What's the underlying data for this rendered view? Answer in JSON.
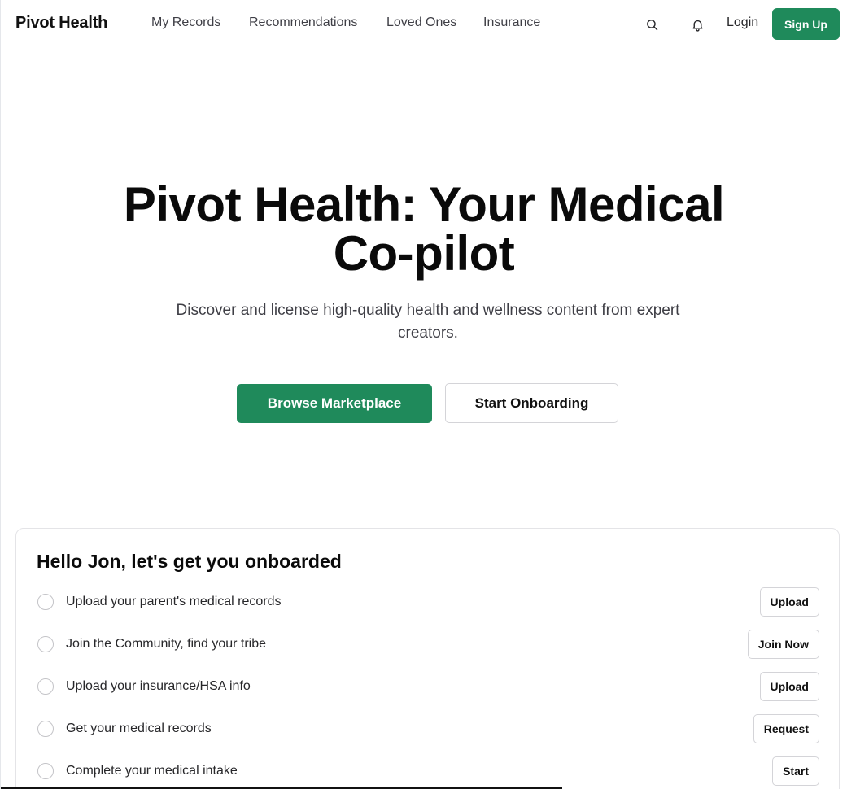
{
  "header": {
    "brand": "Pivot Health",
    "nav": [
      "My Records",
      "Recommendations",
      "Loved Ones",
      "Insurance"
    ],
    "icons": [
      "search-icon",
      "bell-icon"
    ],
    "login_label": "Login",
    "signup_label": "Sign Up"
  },
  "hero": {
    "title_line1": "Pivot Health: Your Medical",
    "title_line2": "Co-pilot",
    "subtitle": "Discover and license high-quality health and wellness content from expert creators.",
    "primary_label": "Browse Marketplace",
    "secondary_label": "Start Onboarding"
  },
  "onboarding": {
    "title": "Hello Jon, let's get you onboarded",
    "tasks": [
      {
        "label": "Upload your parent's medical records",
        "action": "Upload"
      },
      {
        "label": "Join the Community, find your tribe",
        "action": "Join Now"
      },
      {
        "label": "Upload your insurance/HSA info",
        "action": "Upload"
      },
      {
        "label": "Get your medical records",
        "action": "Request"
      },
      {
        "label": "Complete your medical intake",
        "action": "Start"
      }
    ]
  },
  "colors": {
    "accent": "#1f8a5b",
    "text": "#111111",
    "muted": "#3f3f46",
    "border": "#e4e4e7"
  }
}
